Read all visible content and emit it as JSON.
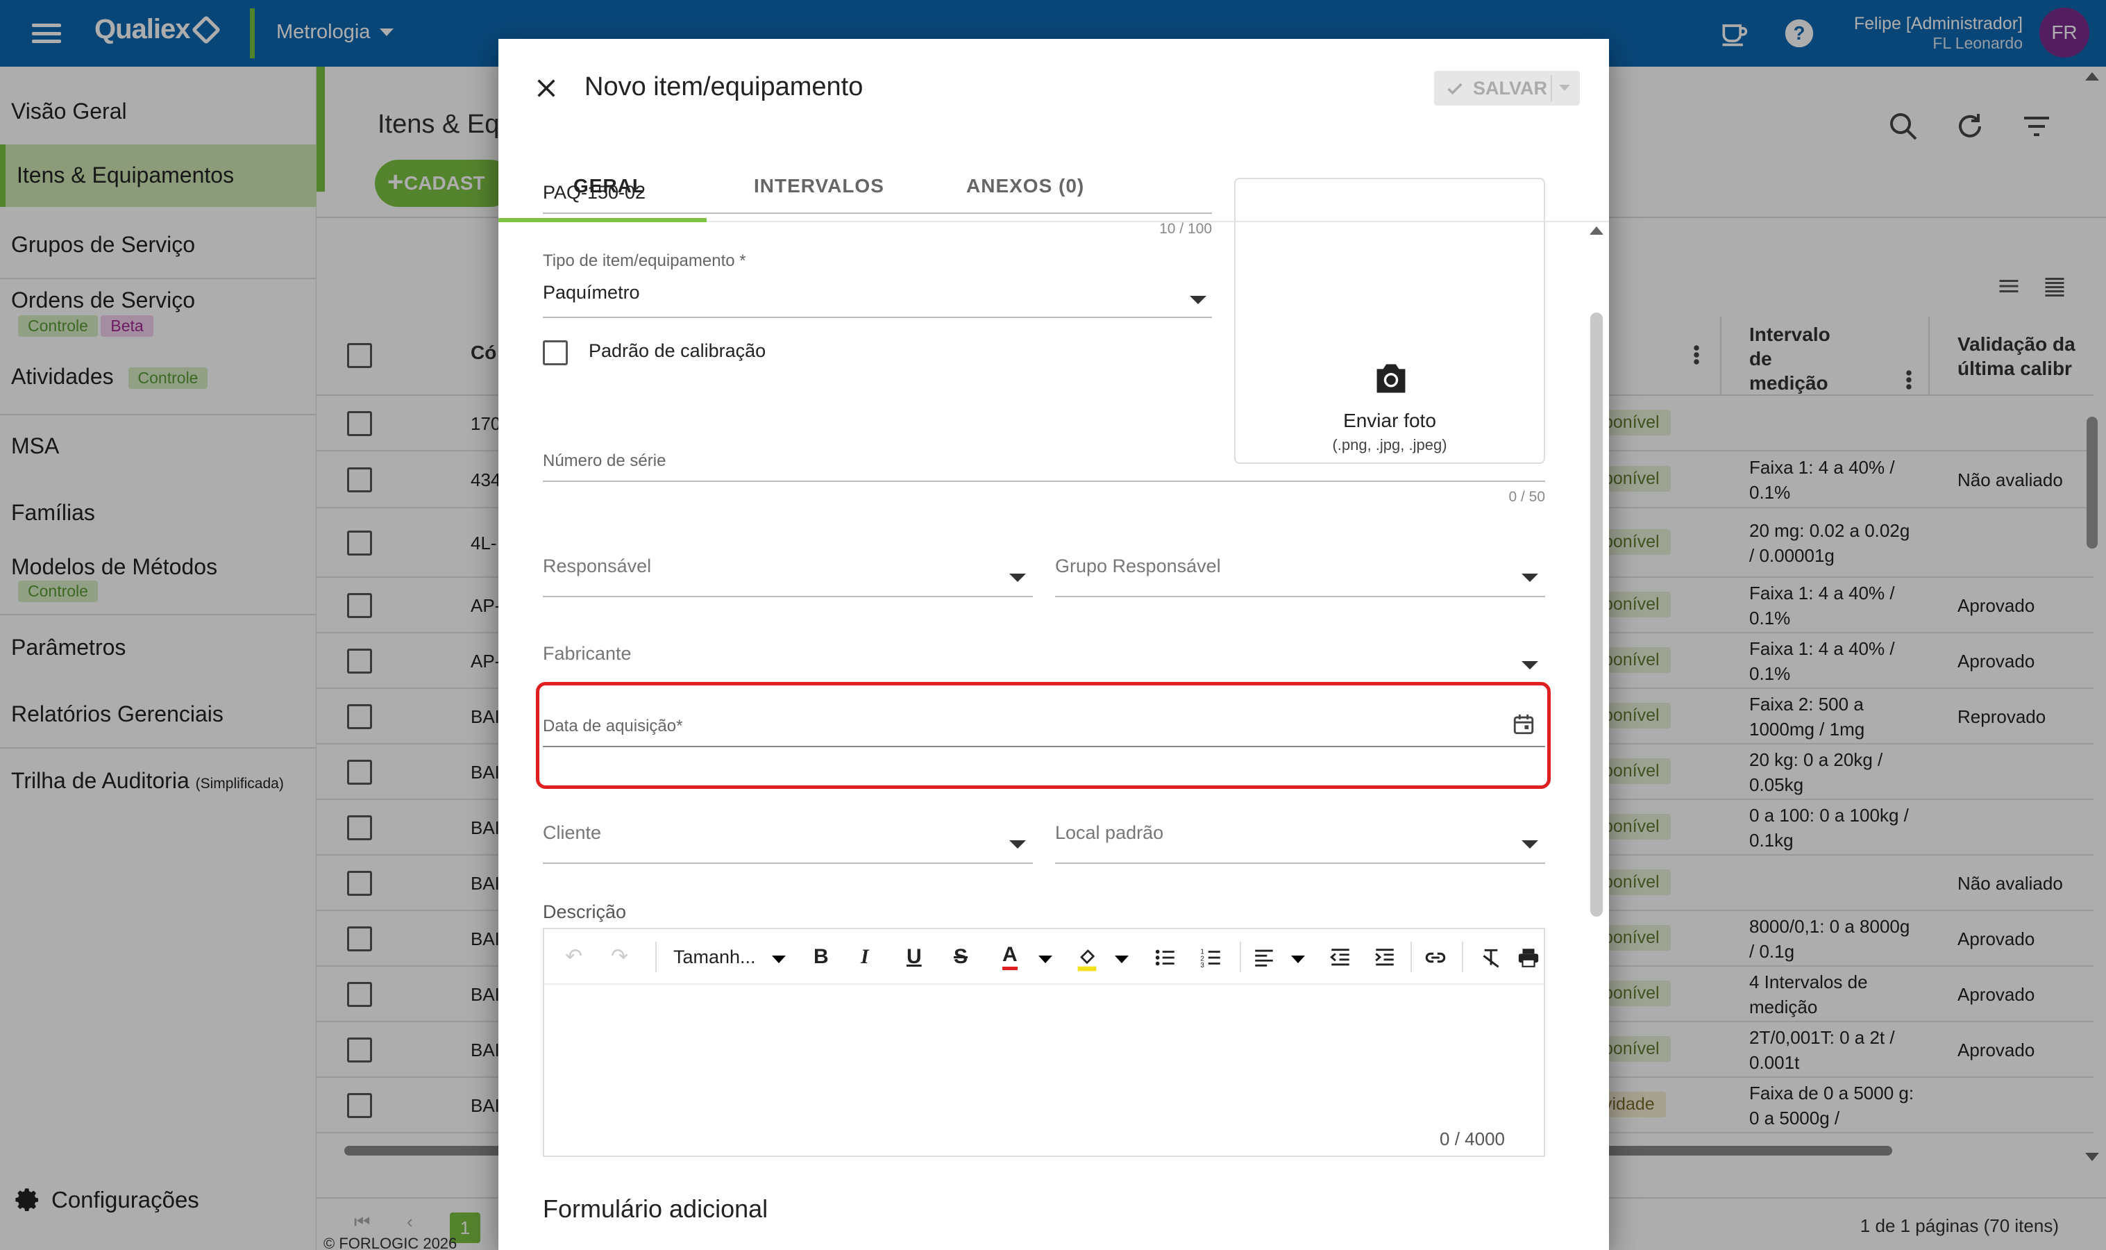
{
  "header": {
    "app_name": "Qualiex",
    "module": "Metrologia",
    "user_name": "Felipe [Administrador]",
    "user_sub": "FL Leonardo",
    "avatar_initials": "FR",
    "brand_color": "#0e68b1",
    "accent_color": "#7dc243",
    "icons": [
      "menu-icon",
      "coffee-cup-icon",
      "help-icon"
    ]
  },
  "sidebar": {
    "items": [
      {
        "label": "Visão Geral"
      },
      {
        "label": "Itens & Equipamentos",
        "active": true
      },
      {
        "label": "Grupos de Serviço"
      },
      {
        "label": "Ordens de Serviço",
        "tags": [
          "Controle",
          "Beta"
        ]
      },
      {
        "label": "Atividades",
        "tags": [
          "Controle"
        ]
      },
      {
        "label": "MSA"
      },
      {
        "label": "Famílias"
      },
      {
        "label": "Modelos de Métodos",
        "tags": [
          "Controle"
        ]
      },
      {
        "label": "Parâmetros"
      },
      {
        "label": "Relatórios Gerenciais"
      },
      {
        "label": "Trilha de Auditoria",
        "suffix": "(Simplificada)"
      }
    ],
    "settings_label": "Configurações",
    "copyright": "© FORLOGIC 2026"
  },
  "page": {
    "title": "Itens & Eq",
    "add_button": "CADAST",
    "columns": {
      "code": "Có",
      "interval": "Intervalo de medição",
      "validation": "Validação da última calibr"
    },
    "rows": [
      {
        "code": "170",
        "status": "ponível",
        "interval": "",
        "validation": ""
      },
      {
        "code": "434",
        "status": "ponível",
        "interval": "Faixa 1: 4 a 40% / 0.1%",
        "validation": "Não avaliado"
      },
      {
        "code": "4L-",
        "status": "ponível",
        "interval": "20 mg: 0.02 a 0.02g / 0.00001g",
        "validation": ""
      },
      {
        "code": "AP-",
        "status": "ponível",
        "interval": "Faixa 1: 4 a 40% / 0.1%",
        "validation": "Aprovado"
      },
      {
        "code": "AP-",
        "status": "ponível",
        "interval": "Faixa 1: 4 a 40% / 0.1%",
        "validation": "Aprovado"
      },
      {
        "code": "BAI",
        "status": "ponível",
        "interval": "Faixa 2: 500 a 1000mg / 1mg",
        "validation": "Reprovado"
      },
      {
        "code": "BAI",
        "status": "ponível",
        "interval": "20 kg: 0 a 20kg / 0.05kg",
        "validation": ""
      },
      {
        "code": "BAI",
        "status": "ponível",
        "interval": "0 a 100: 0 a 100kg / 0.1kg",
        "validation": ""
      },
      {
        "code": "BAI",
        "status": "ponível",
        "interval": "",
        "validation": "Não avaliado"
      },
      {
        "code": "BAI",
        "status": "ponível",
        "interval": "8000/0,1: 0 a 8000g / 0.1g",
        "validation": "Aprovado"
      },
      {
        "code": "BAI",
        "status": "ponível",
        "interval": "4 Intervalos de medição",
        "validation": "Aprovado"
      },
      {
        "code": "BAI",
        "status": "ponível",
        "interval": "2T/0,001T: 0 a 2t / 0.001t",
        "validation": "Aprovado"
      },
      {
        "code": "BAI",
        "status": "vidade",
        "interval": "Faixa de 0 a 5000 g: 0 a 5000g /",
        "validation": ""
      }
    ],
    "pager": {
      "current_page": "1",
      "info": "1 de 1 páginas (70 itens)"
    }
  },
  "dialog": {
    "title": "Novo item/equipamento",
    "save_label": "SALVAR",
    "tabs": [
      "GERAL",
      "INTERVALOS",
      "ANEXOS (0)"
    ],
    "active_tab": "GERAL",
    "code_value": "PAQ-150-02",
    "code_counter": "10 / 100",
    "type_label": "Tipo de item/equipamento *",
    "type_value": "Paquímetro",
    "calibration_standard_label": "Padrão de calibração",
    "photo_label": "Enviar foto",
    "photo_formats": "(.png, .jpg, .jpeg)",
    "serial_label": "Número de série",
    "serial_counter": "0 / 50",
    "responsible_label": "Responsável",
    "responsible_group_label": "Grupo Responsável",
    "manufacturer_label": "Fabricante",
    "acquisition_date_label": "Data de aquisição*",
    "client_label": "Cliente",
    "default_location_label": "Local padrão",
    "description_label": "Descrição",
    "editor": {
      "font_size_label": "Tamanh...",
      "counter": "0 / 4000"
    },
    "additional_form_label": "Formulário adicional",
    "highlight_color": "#e02020"
  }
}
